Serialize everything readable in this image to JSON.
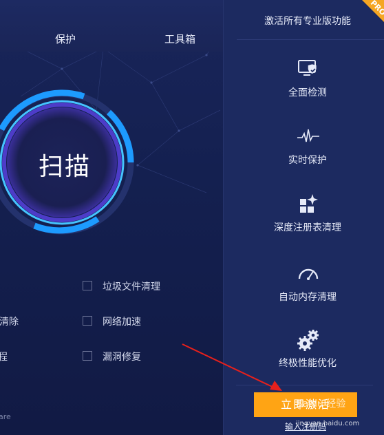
{
  "nav": {
    "protect": "保护",
    "toolbox": "工具箱"
  },
  "scan": {
    "label": "扫描"
  },
  "options": [
    {
      "label": "垃圾文件清理",
      "checked": false
    },
    {
      "label": "网络加速",
      "checked": false
    },
    {
      "label": "漏洞修复",
      "checked": false
    }
  ],
  "left_partial": {
    "row2": "清除",
    "row3": "程",
    "footer": "are"
  },
  "upgrade": {
    "title": "激活所有专业版功能",
    "badge": "PRO",
    "features": [
      {
        "label": "全面检测",
        "icon": "monitor-shield-icon"
      },
      {
        "label": "实时保护",
        "icon": "heartbeat-icon"
      },
      {
        "label": "深度注册表清理",
        "icon": "registry-sparkle-icon"
      },
      {
        "label": "自动内存清理",
        "icon": "speedometer-icon"
      },
      {
        "label": "终极性能优化",
        "icon": "gears-icon"
      }
    ],
    "activate_label": "立即激活",
    "code_link": "输入注册码"
  },
  "watermark": {
    "text": "Baidu 经验",
    "sub": "jingyan.baidu.com"
  },
  "colors": {
    "background": "#141d48",
    "sidebar": "#1c2a60",
    "ring": "#1fa6ff",
    "activate": "#ffa414",
    "pro_ribbon": "#f5a623",
    "annotation_arrow": "#e8201b"
  }
}
